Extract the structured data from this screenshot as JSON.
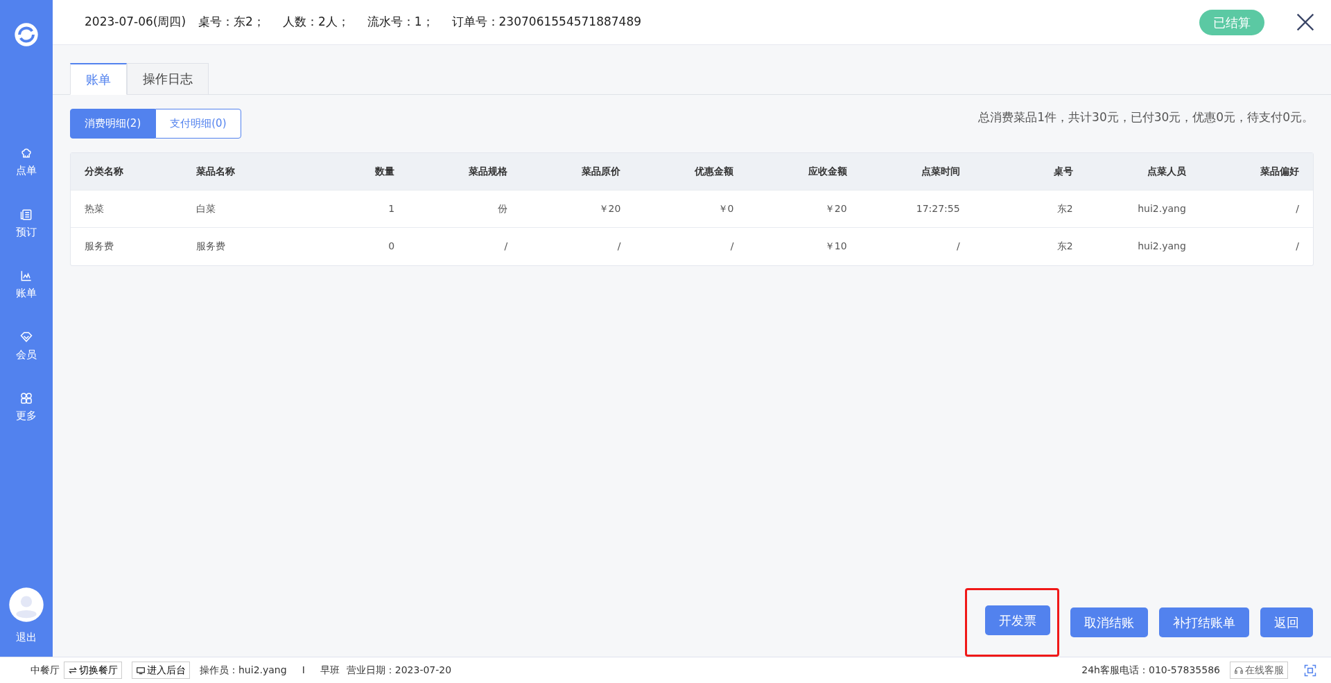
{
  "sidebar": {
    "items": [
      {
        "label": "点单",
        "kind": "chef"
      },
      {
        "label": "预订",
        "kind": "book"
      },
      {
        "label": "账单",
        "kind": "chart"
      },
      {
        "label": "会员",
        "kind": "gem"
      },
      {
        "label": "更多",
        "kind": "grid"
      }
    ],
    "logout": "退出"
  },
  "header": {
    "date": "2023-07-06(周四)",
    "fields": [
      "桌号：东2；",
      "人数：2人；",
      "流水号：1；",
      "订单号：2307061554571887489"
    ],
    "status": "已结算"
  },
  "tabs": [
    {
      "label": "账单",
      "selected": true
    },
    {
      "label": "操作日志",
      "selected": false
    }
  ],
  "subtabs": [
    {
      "label": "消费明细(2)",
      "selected": true
    },
    {
      "label": "支付明细(0)",
      "selected": false
    }
  ],
  "summary": "总消费菜品1件，共计30元，已付30元，优惠0元，待支付0元。",
  "table": {
    "columns": [
      "分类名称",
      "菜品名称",
      "数量",
      "菜品规格",
      "菜品原价",
      "优惠金额",
      "应收金额",
      "点菜时间",
      "桌号",
      "点菜人员",
      "菜品偏好"
    ],
    "rows": [
      [
        "热菜",
        "白菜",
        "1",
        "份",
        "￥20",
        "￥0",
        "￥20",
        "17:27:55",
        "东2",
        "hui2.yang",
        "/"
      ],
      [
        "服务费",
        "服务费",
        "0",
        "/",
        "/",
        "/",
        "￥10",
        "/",
        "东2",
        "hui2.yang",
        "/"
      ]
    ]
  },
  "buttons": [
    {
      "label": "开发票",
      "highlighted": true
    },
    {
      "label": "取消结账",
      "highlighted": false
    },
    {
      "label": "补打结账单",
      "highlighted": false
    },
    {
      "label": "返回",
      "highlighted": false
    }
  ],
  "status_bar": {
    "hall": "中餐厅",
    "switch": "切换餐厅",
    "backend": "进入后台",
    "operator": "操作员：hui2.yang",
    "separator": "I",
    "shift": "早班",
    "business_date": "营业日期：2023-07-20",
    "hotline": "24h客服电话：010-57835586",
    "service": "在线客服"
  }
}
